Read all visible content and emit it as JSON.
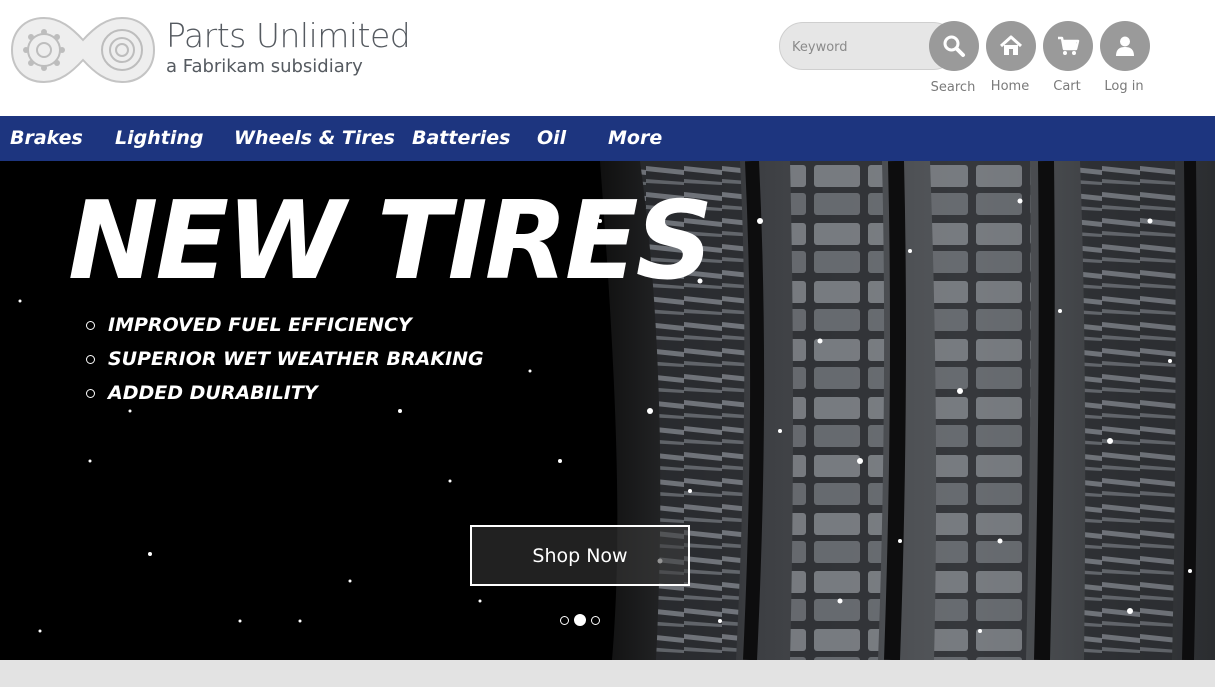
{
  "brand": {
    "name": "Parts Unlimited",
    "subtitle": "a Fabrikam subsidiary"
  },
  "search": {
    "placeholder": "Keyword",
    "button_label": "Search"
  },
  "header_actions": {
    "home_label": "Home",
    "cart_label": "Cart",
    "login_label": "Log in"
  },
  "nav": {
    "items": [
      "Brakes",
      "Lighting",
      "Wheels & Tires",
      "Batteries",
      "Oil",
      "More"
    ]
  },
  "hero": {
    "title": "NEW TIRES",
    "bullets": [
      "IMPROVED FUEL EFFICIENCY",
      "SUPERIOR WET WEATHER BRAKING",
      "ADDED DURABILITY"
    ],
    "cta_label": "Shop Now",
    "slides_total": 3,
    "active_slide": 2
  },
  "colors": {
    "nav_background": "#1d357f",
    "header_icon_circle": "#9a9a9a",
    "hero_background": "#000000",
    "footer_strip": "#e3e3e3"
  },
  "icons": [
    "gears-logo-icon",
    "search-icon",
    "home-icon",
    "cart-icon",
    "user-icon"
  ]
}
